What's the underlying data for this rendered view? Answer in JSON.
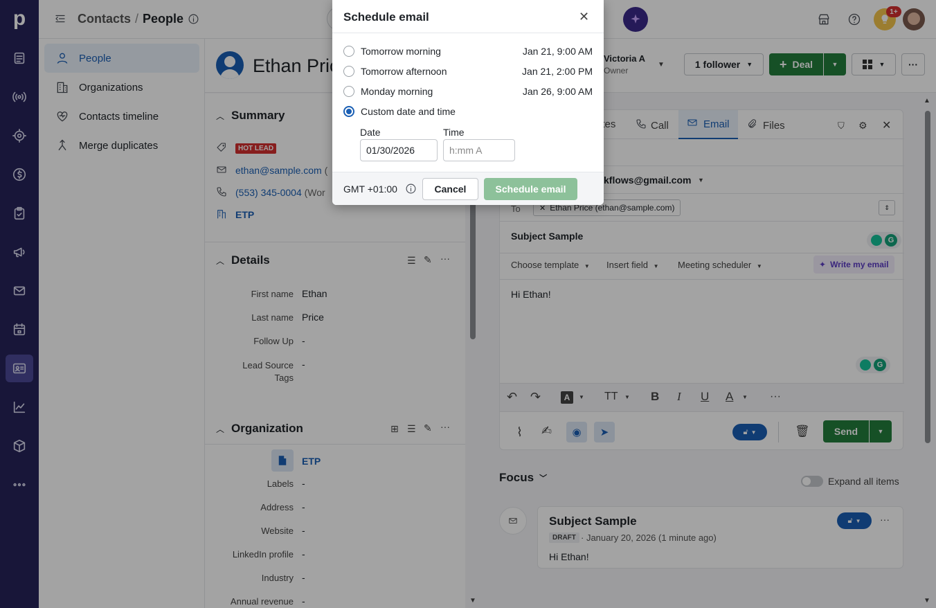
{
  "app": {
    "logo": "p"
  },
  "breadcrumb": {
    "parent": "Contacts",
    "separator": "/",
    "current": "People"
  },
  "sidebar": {
    "items": [
      {
        "label": "People",
        "icon": "person-icon"
      },
      {
        "label": "Organizations",
        "icon": "building-icon"
      },
      {
        "label": "Contacts timeline",
        "icon": "heart-pulse-icon"
      },
      {
        "label": "Merge duplicates",
        "icon": "merge-icon"
      }
    ]
  },
  "notifications": {
    "count": "1+"
  },
  "person": {
    "name": "Ethan Price",
    "owner_name": "Victoria A",
    "owner_role": "Owner",
    "followers": "1 follower",
    "deal_label": "Deal"
  },
  "summary": {
    "title": "Summary",
    "tag": "HOT LEAD",
    "email": "ethan@sample.com",
    "email_suffix": "(",
    "phone": "(553) 345-0004",
    "phone_suffix": "(Wor",
    "org": "ETP"
  },
  "details": {
    "title": "Details",
    "fields": [
      {
        "label": "First name",
        "value": "Ethan"
      },
      {
        "label": "Last name",
        "value": "Price"
      },
      {
        "label": "Follow Up",
        "value": "-"
      },
      {
        "label": "Lead Source\nTags",
        "value": "-"
      }
    ]
  },
  "organization": {
    "title": "Organization",
    "name": "ETP",
    "fields": [
      {
        "label": "Labels",
        "value": "-"
      },
      {
        "label": "Address",
        "value": "-"
      },
      {
        "label": "Website",
        "value": "-"
      },
      {
        "label": "LinkedIn profile",
        "value": "-"
      },
      {
        "label": "Industry",
        "value": "-"
      },
      {
        "label": "Annual revenue",
        "value": "-"
      }
    ]
  },
  "composer": {
    "tabs": [
      {
        "label": "otes",
        "icon": "notes-icon"
      },
      {
        "label": "Call",
        "icon": "phone-icon"
      },
      {
        "label": "Email",
        "icon": "mail-icon"
      },
      {
        "label": "Files",
        "icon": "paperclip-icon"
      }
    ],
    "from": "kflows@gmail.com",
    "to_label": "To",
    "recipient": "Ethan Price (ethan@sample.com)",
    "subject": "Subject Sample",
    "template_label": "Choose template",
    "insert_field_label": "Insert field",
    "meeting_label": "Meeting scheduler",
    "write_label": "Write my email",
    "body": "Hi Ethan!",
    "send_label": "Send"
  },
  "focus": {
    "title": "Focus",
    "expand_label": "Expand all items",
    "item_subject": "Subject Sample",
    "item_badge": "DRAFT",
    "item_date": "· January 20, 2026 (1 minute ago)",
    "item_body": "Hi Ethan!"
  },
  "modal": {
    "title": "Schedule email",
    "options": [
      {
        "label": "Tomorrow morning",
        "date": "Jan 21, 9:00 AM",
        "selected": false
      },
      {
        "label": "Tomorrow afternoon",
        "date": "Jan 21, 2:00 PM",
        "selected": false
      },
      {
        "label": "Monday morning",
        "date": "Jan 26, 9:00 AM",
        "selected": false
      },
      {
        "label": "Custom date and time",
        "date": "",
        "selected": true
      }
    ],
    "date_label": "Date",
    "date_value": "01/30/2026",
    "time_label": "Time",
    "time_placeholder": "h:mm A",
    "timezone": "GMT +01:00",
    "cancel_label": "Cancel",
    "schedule_label": "Schedule email"
  },
  "colors": {
    "nav_bg": "#26235a",
    "accent_blue": "#1a5fb4",
    "green": "#237d3c",
    "green_disabled": "#8dc19a",
    "hot_lead": "#d42f2f"
  }
}
